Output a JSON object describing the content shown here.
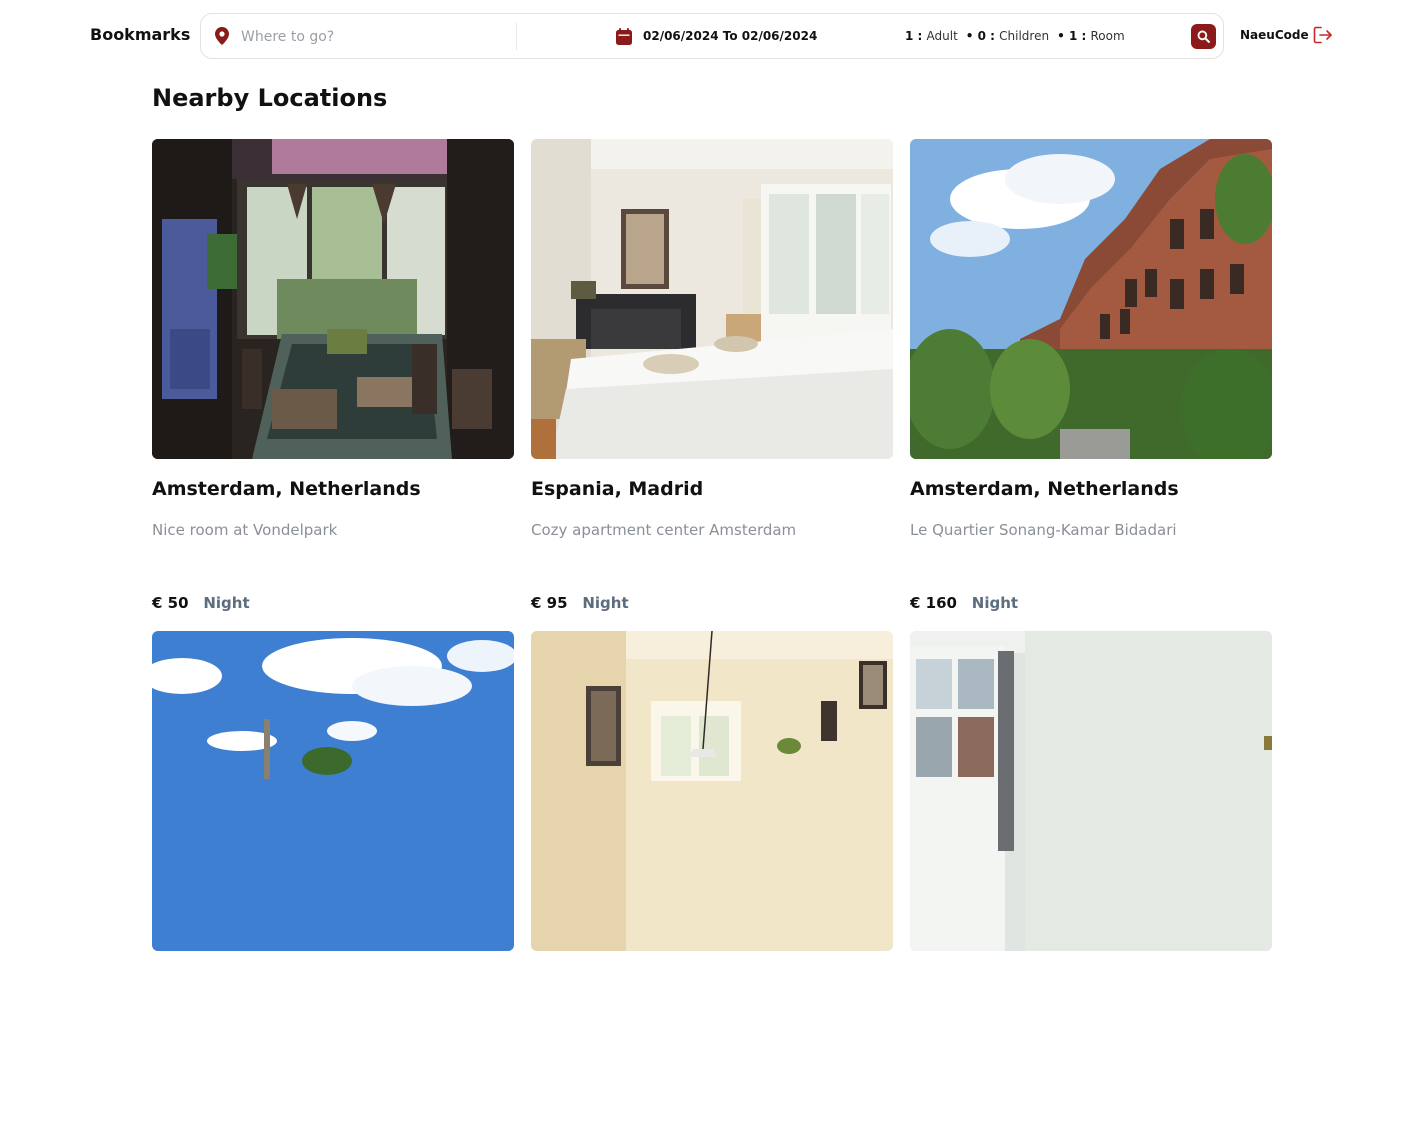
{
  "header": {
    "brand": "Bookmarks",
    "search": {
      "placeholder": "Where to go?",
      "value": ""
    },
    "dates": "02/06/2024 To 02/06/2024",
    "guests": {
      "adult_count": "1",
      "adult_label": "Adult",
      "children_count": "0",
      "children_label": "Children",
      "room_count": "1",
      "room_label": "Room"
    },
    "username": "NaeuCode"
  },
  "main": {
    "section_title": "Nearby Locations",
    "listings": [
      {
        "title": "Amsterdam, Netherlands",
        "description": "Nice room at Vondelpark",
        "price": "€ 50",
        "unit": "Night"
      },
      {
        "title": "Espania, Madrid",
        "description": "Cozy apartment center Amsterdam",
        "price": "€ 95",
        "unit": "Night"
      },
      {
        "title": "Amsterdam, Netherlands",
        "description": "Le Quartier Sonang-Kamar Bidadari",
        "price": "€ 160",
        "unit": "Night"
      },
      {
        "title": "",
        "description": "",
        "price": "",
        "unit": ""
      },
      {
        "title": "",
        "description": "",
        "price": "",
        "unit": ""
      },
      {
        "title": "",
        "description": "",
        "price": "",
        "unit": ""
      }
    ]
  },
  "colors": {
    "accent": "#8b1a1a",
    "muted_text": "#8a8f98",
    "unit_text": "#5d6d80",
    "logout": "#c62828"
  },
  "icons": {
    "location": "map-pin-icon",
    "calendar": "calendar-icon",
    "search": "search-icon",
    "logout": "logout-icon"
  }
}
